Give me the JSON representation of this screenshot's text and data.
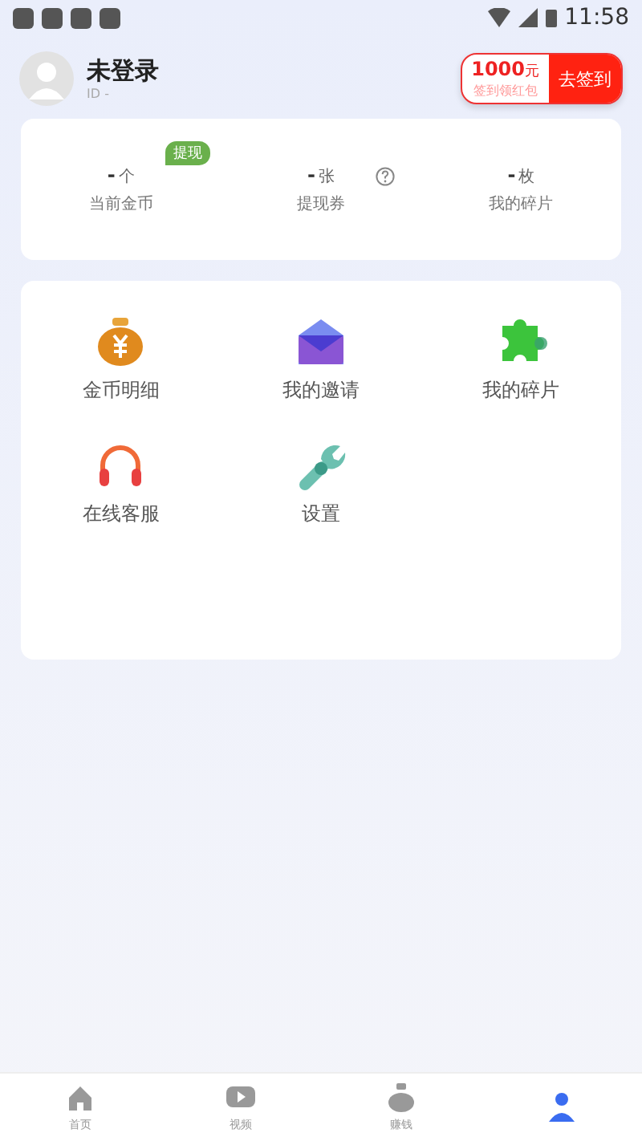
{
  "status_bar": {
    "time": "11:58"
  },
  "profile": {
    "name": "未登录",
    "id": "ID -"
  },
  "checkin": {
    "amount": "1000",
    "unit": "元",
    "subtitle": "签到领红包",
    "button": "去签到"
  },
  "stats": [
    {
      "value": "-",
      "unit": "个",
      "label": "当前金币",
      "badge": "提现",
      "help": false
    },
    {
      "value": "-",
      "unit": "张",
      "label": "提现券",
      "help": true
    },
    {
      "value": "-",
      "unit": "枚",
      "label": "我的碎片",
      "help": false
    }
  ],
  "menu": [
    {
      "kind": "coin",
      "label": "金币明细"
    },
    {
      "kind": "mail",
      "label": "我的邀请"
    },
    {
      "kind": "puzzle",
      "label": "我的碎片"
    },
    {
      "kind": "headset",
      "label": "在线客服"
    },
    {
      "kind": "wrench",
      "label": "设置"
    }
  ],
  "tabs": [
    {
      "kind": "home",
      "label": "首页",
      "selected": false
    },
    {
      "kind": "video",
      "label": "视频",
      "selected": false
    },
    {
      "kind": "bag",
      "label": "赚钱",
      "selected": false
    },
    {
      "kind": "me",
      "selected": true
    }
  ]
}
